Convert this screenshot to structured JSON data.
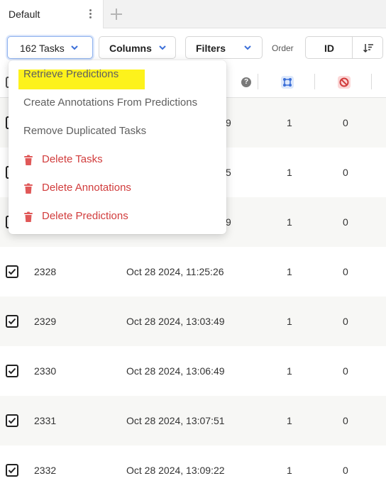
{
  "tabs": [
    {
      "label": "Default",
      "icon": "kebab-menu-icon"
    }
  ],
  "tab_add_icon": "plus-icon",
  "toolbar": {
    "tasks_label": "162 Tasks",
    "columns_label": "Columns",
    "filters_label": "Filters",
    "order_label": "Order",
    "order_field": "ID",
    "sort_icon": "sort-descending-icon"
  },
  "header_icons": {
    "help": "?",
    "annotations": "annotations-icon",
    "cancelled": "cancelled-icon"
  },
  "menu": {
    "items": [
      {
        "label": "Retrieve Predictions",
        "type": "plain",
        "highlighted": true
      },
      {
        "label": "Create Annotations From Predictions",
        "type": "plain"
      },
      {
        "label": "Remove Duplicated Tasks",
        "type": "plain"
      },
      {
        "label": "Delete Tasks",
        "type": "danger",
        "icon": "trash-icon"
      },
      {
        "label": "Delete Annotations",
        "type": "danger",
        "icon": "trash-icon"
      },
      {
        "label": "Delete Predictions",
        "type": "danger",
        "icon": "trash-icon"
      }
    ]
  },
  "rows": [
    {
      "id": "",
      "date_tail": "9",
      "annotations": "1",
      "cancelled": "0",
      "checked": true
    },
    {
      "id": "",
      "date_tail": "5",
      "annotations": "1",
      "cancelled": "0",
      "checked": true
    },
    {
      "id": "",
      "date_tail": "9",
      "annotations": "1",
      "cancelled": "0",
      "checked": true
    },
    {
      "id": "2328",
      "date": "Oct 28 2024, 11:25:26",
      "annotations": "1",
      "cancelled": "0",
      "checked": true
    },
    {
      "id": "2329",
      "date": "Oct 28 2024, 13:03:49",
      "annotations": "1",
      "cancelled": "0",
      "checked": true
    },
    {
      "id": "2330",
      "date": "Oct 28 2024, 13:06:49",
      "annotations": "1",
      "cancelled": "0",
      "checked": true
    },
    {
      "id": "2331",
      "date": "Oct 28 2024, 13:07:51",
      "annotations": "1",
      "cancelled": "0",
      "checked": true
    },
    {
      "id": "2332",
      "date": "Oct 28 2024, 13:09:22",
      "annotations": "1",
      "cancelled": "0",
      "checked": true
    }
  ],
  "colors": {
    "accent": "#3b6fd8",
    "danger": "#d13c3c",
    "highlight": "#fdf21c"
  }
}
